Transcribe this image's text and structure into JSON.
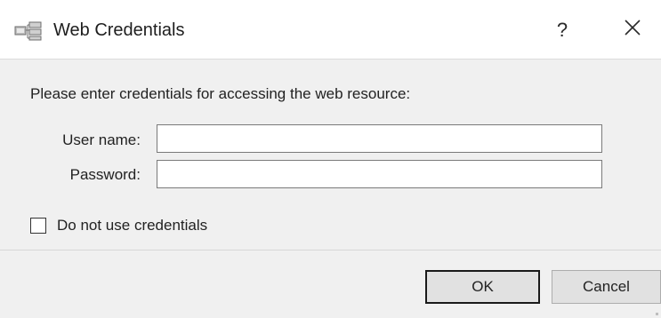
{
  "window": {
    "title": "Web Credentials",
    "icon": "network-share-icon",
    "help_label": "?",
    "close_label": "✕"
  },
  "form": {
    "prompt": "Please enter credentials for accessing the web resource:",
    "user_label": "User name:",
    "user_value": "",
    "password_label": "Password:",
    "password_value": "",
    "no_credentials_label": "Do not use credentials",
    "no_credentials_checked": false
  },
  "buttons": {
    "ok_label": "OK",
    "cancel_label": "Cancel"
  }
}
